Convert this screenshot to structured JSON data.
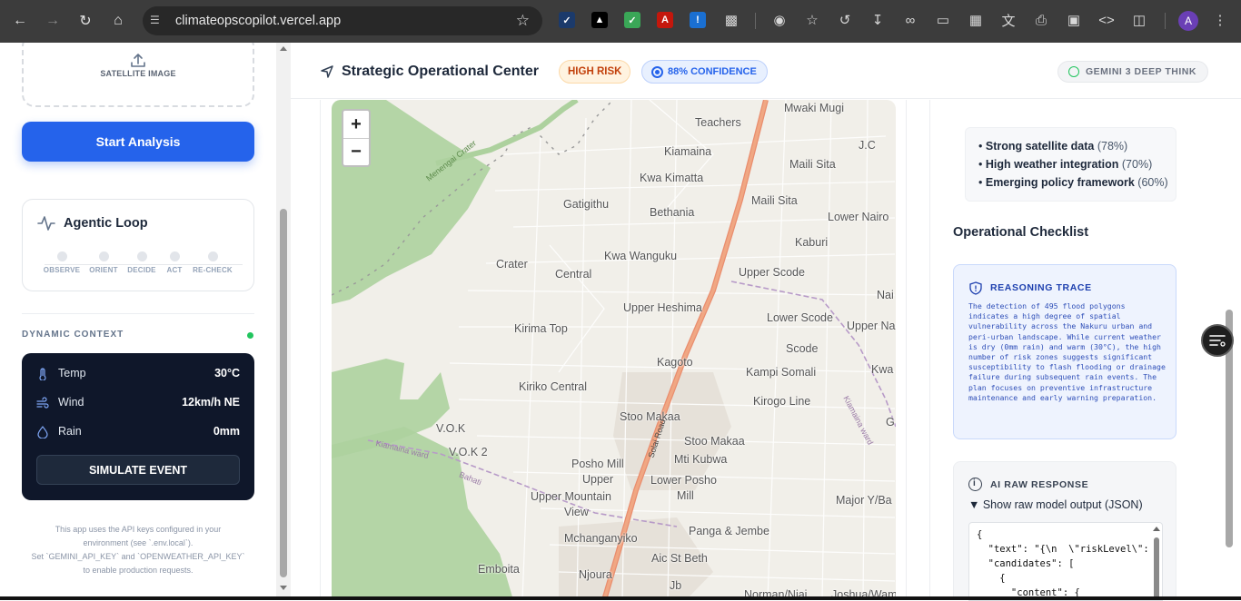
{
  "browser": {
    "url": "climateopscopilot.vercel.app",
    "profile_initial": "A"
  },
  "sidebar": {
    "upload_label": "SATELLITE IMAGE",
    "start_button": "Start Analysis",
    "agentic_loop": {
      "title": "Agentic Loop",
      "steps": [
        "OBSERVE",
        "ORIENT",
        "DECIDE",
        "ACT",
        "RE-CHECK"
      ]
    },
    "dynamic_context": {
      "label": "DYNAMIC CONTEXT",
      "status_color": "#22c55e",
      "rows": [
        {
          "key": "Temp",
          "value": "30°C",
          "icon": "thermometer-icon"
        },
        {
          "key": "Wind",
          "value": "12km/h NE",
          "icon": "wind-icon"
        },
        {
          "key": "Rain",
          "value": "0mm",
          "icon": "droplet-icon"
        }
      ],
      "simulate_button": "SIMULATE EVENT"
    },
    "footnote": {
      "line1": "This app uses the API keys configured in your",
      "line2": "environment (see `.env.local`).",
      "line3": "Set `GEMINI_API_KEY` and `OPENWEATHER_API_KEY`",
      "line4": "to enable production requests."
    }
  },
  "header": {
    "title": "Strategic Operational Center",
    "risk_badge": "HIGH RISK",
    "confidence_badge": "88% CONFIDENCE",
    "model_badge": "GEMINI 3 DEEP THINK"
  },
  "map": {
    "zoom_in": "+",
    "zoom_out": "−",
    "places": {
      "mwaki_mugi": "Mwaki Mugi",
      "teachers": "Teachers",
      "jc": "J.C",
      "kiamaina": "Kiamaina",
      "maili_sita_1": "Maili Sita",
      "kwa_kimatta": "Kwa Kimatta",
      "maili_sita_2": "Maili Sita",
      "gatigithu": "Gatigithu",
      "bethania": "Bethania",
      "lower_nairo": "Lower Nairo",
      "kaburi": "Kaburi",
      "kwa_wanguku": "Kwa Wanguku",
      "crater": "Crater",
      "central": "Central",
      "upper_scode": "Upper Scode",
      "nai": "Nai",
      "upper_heshima": "Upper Heshima",
      "lower_scode": "Lower Scode",
      "kirima_top": "Kirima Top",
      "upper_na": "Upper Na",
      "scode": "Scode",
      "kagoto": "Kagoto",
      "kampi_somali": "Kampi Somali",
      "kwa": "Kwa",
      "kiriko_central": "Kiriko Central",
      "kirogo_line": "Kirogo Line",
      "stoo_makaa_1": "Stoo Makaa",
      "g": "G",
      "vok": "V.O.K",
      "stoo_makaa_2": "Stoo Makaa",
      "vok2": "V.O.K 2",
      "mti_kubwa": "Mti Kubwa",
      "posho_mill": "Posho Mill",
      "upper": "Upper",
      "lower_posho": "Lower Posho",
      "upper_mountain": "Upper Mountain",
      "mill": "Mill",
      "major_yba": "Major Y/Ba",
      "view": "View",
      "panga_jembe": "Panga & Jembe",
      "mchanganyiko": "Mchanganyiko",
      "aic_st_beth": "Aic St Beth",
      "emboita": "Emboita",
      "njoura": "Njoura",
      "jb": "Jb",
      "norman_njai": "Norman/Njai",
      "joshua_wambu": "Joshua/Wambu"
    },
    "road_label": "Solai Road",
    "crater_label": "Menengai Crater",
    "ward_labels": {
      "kiamaina_ward_1": "Kiamaina ward",
      "bahati": "Bahati",
      "kiamaina_ward_2": "Kiamaina ward"
    }
  },
  "right_panel": {
    "strengths": [
      {
        "label": "Strong satellite data",
        "pct": "(78%)"
      },
      {
        "label": "High weather integration",
        "pct": "(70%)"
      },
      {
        "label": "Emerging policy framework",
        "pct": "(60%)"
      }
    ],
    "checklist_title": "Operational Checklist",
    "reasoning": {
      "title": "REASONING TRACE",
      "body": "The detection of 495 flood polygons indicates a high degree of spatial vulnerability across the Nakuru urban and peri-urban landscape. While current weather is dry (0mm rain) and warm (30°C), the high number of risk zones suggests significant susceptibility to flash flooding or drainage failure during subsequent rain events. The plan focuses on preventive infrastructure maintenance and early warning preparation."
    },
    "raw": {
      "title": "AI RAW RESPONSE",
      "summary": "▼ Show raw model output (JSON)",
      "code": "{\n  \"text\": \"{\\n  \\\"riskLevel\\\":\n  \"candidates\": [\n    {\n      \"content\": {"
    }
  }
}
